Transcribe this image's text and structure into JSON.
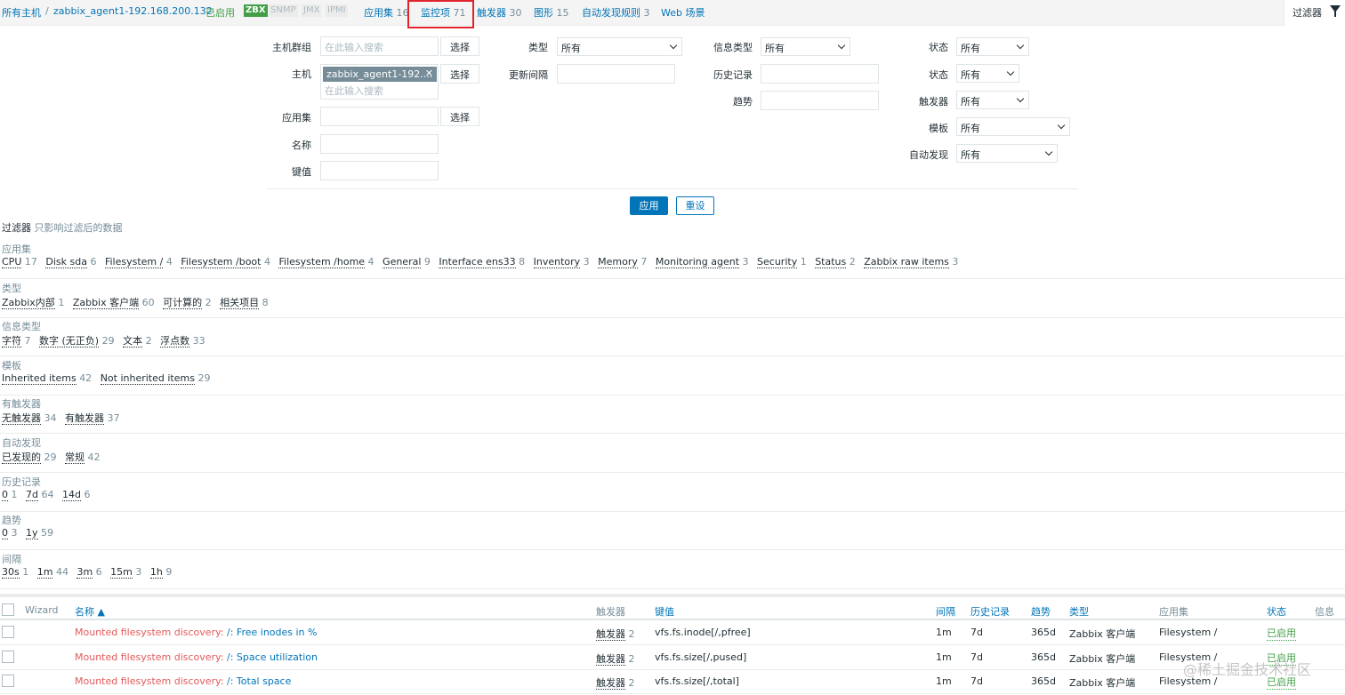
{
  "nav": {
    "all_hosts": "所有主机",
    "separator": "/",
    "host": "zabbix_agent1-192.168.200.132",
    "enabled": "已启用",
    "zbx": "ZBX",
    "snmp": "SNMP",
    "jmx": "JMX",
    "ipmi": "IPMI",
    "applications": "应用集",
    "applications_count": "16",
    "items": "监控项",
    "items_count": "71",
    "triggers": "触发器",
    "triggers_count": "30",
    "graphs": "图形",
    "graphs_count": "15",
    "discovery": "自动发现规则",
    "discovery_count": "3",
    "web": "Web 场景",
    "filter_tab": "过滤器"
  },
  "filter": {
    "host_group_label": "主机群组",
    "host_group_placeholder": "在此输入搜索",
    "select_btn": "选择",
    "host_label": "主机",
    "host_tag": "zabbix_agent1-192....",
    "host_placeholder": "在此输入搜索",
    "app_label": "应用集",
    "name_label": "名称",
    "key_label": "键值",
    "type_label": "类型",
    "type_value": "所有",
    "update_interval_label": "更新间隔",
    "info_type_label": "信息类型",
    "info_type_value": "所有",
    "history_label": "历史记录",
    "trends_label": "趋势",
    "state_label": "状态",
    "state_value": "所有",
    "status_label": "状态",
    "status_value": "所有",
    "triggers_label": "触发器",
    "triggers_value": "所有",
    "template_label": "模板",
    "template_value": "所有",
    "discovery_label": "自动发现",
    "discovery_value": "所有",
    "apply_btn": "应用",
    "reset_btn": "重设"
  },
  "subfilter": {
    "title": "过滤器",
    "note": "只影响过滤后的数据",
    "groups": [
      {
        "name": "应用集",
        "values": [
          {
            "t": "CPU",
            "n": "17"
          },
          {
            "t": "Disk sda",
            "n": "6"
          },
          {
            "t": "Filesystem /",
            "n": "4"
          },
          {
            "t": "Filesystem /boot",
            "n": "4"
          },
          {
            "t": "Filesystem /home",
            "n": "4"
          },
          {
            "t": "General",
            "n": "9"
          },
          {
            "t": "Interface ens33",
            "n": "8"
          },
          {
            "t": "Inventory",
            "n": "3"
          },
          {
            "t": "Memory",
            "n": "7"
          },
          {
            "t": "Monitoring agent",
            "n": "3"
          },
          {
            "t": "Security",
            "n": "1"
          },
          {
            "t": "Status",
            "n": "2"
          },
          {
            "t": "Zabbix raw items",
            "n": "3"
          }
        ]
      },
      {
        "name": "类型",
        "values": [
          {
            "t": "Zabbix内部",
            "n": "1"
          },
          {
            "t": "Zabbix 客户端",
            "n": "60"
          },
          {
            "t": "可计算的",
            "n": "2"
          },
          {
            "t": "相关项目",
            "n": "8"
          }
        ]
      },
      {
        "name": "信息类型",
        "values": [
          {
            "t": "字符",
            "n": "7"
          },
          {
            "t": "数字 (无正负)",
            "n": "29"
          },
          {
            "t": "文本",
            "n": "2"
          },
          {
            "t": "浮点数",
            "n": "33"
          }
        ]
      },
      {
        "name": "模板",
        "values": [
          {
            "t": "Inherited items",
            "n": "42"
          },
          {
            "t": "Not inherited items",
            "n": "29"
          }
        ]
      },
      {
        "name": "有触发器",
        "values": [
          {
            "t": "无触发器",
            "n": "34"
          },
          {
            "t": "有触发器",
            "n": "37"
          }
        ]
      },
      {
        "name": "自动发现",
        "values": [
          {
            "t": "已发现的",
            "n": "29"
          },
          {
            "t": "常规",
            "n": "42"
          }
        ]
      },
      {
        "name": "历史记录",
        "values": [
          {
            "t": "0",
            "n": "1"
          },
          {
            "t": "7d",
            "n": "64"
          },
          {
            "t": "14d",
            "n": "6"
          }
        ]
      },
      {
        "name": "趋势",
        "values": [
          {
            "t": "0",
            "n": "3"
          },
          {
            "t": "1y",
            "n": "59"
          }
        ]
      },
      {
        "name": "间隔",
        "values": [
          {
            "t": "30s",
            "n": "1"
          },
          {
            "t": "1m",
            "n": "44"
          },
          {
            "t": "3m",
            "n": "6"
          },
          {
            "t": "15m",
            "n": "3"
          },
          {
            "t": "1h",
            "n": "9"
          }
        ]
      }
    ]
  },
  "table": {
    "headers": {
      "wizard": "Wizard",
      "name": "名称 ▲",
      "triggers": "触发器",
      "key": "键值",
      "interval": "间隔",
      "history": "历史记录",
      "trends": "趋势",
      "type": "类型",
      "applications": "应用集",
      "status": "状态",
      "info": "信息"
    },
    "rows": [
      {
        "prefix": "Mounted filesystem discovery:",
        "name": " /: Free inodes in %",
        "trig": "触发器",
        "trig_n": "2",
        "key": "vfs.fs.inode[/,pfree]",
        "interval": "1m",
        "history": "7d",
        "trends": "365d",
        "type": "Zabbix 客户端",
        "app": "Filesystem /",
        "status": "已启用"
      },
      {
        "prefix": "Mounted filesystem discovery:",
        "name": " /: Space utilization",
        "trig": "触发器",
        "trig_n": "2",
        "key": "vfs.fs.size[/,pused]",
        "interval": "1m",
        "history": "7d",
        "trends": "365d",
        "type": "Zabbix 客户端",
        "app": "Filesystem /",
        "status": "已启用"
      },
      {
        "prefix": "Mounted filesystem discovery:",
        "name": " /: Total space",
        "trig": "触发器",
        "trig_n": "2",
        "key": "vfs.fs.size[/,total]",
        "interval": "1m",
        "history": "7d",
        "trends": "365d",
        "type": "Zabbix 客户端",
        "app": "Filesystem /",
        "status": "已启用"
      }
    ]
  },
  "watermark": "@稀土掘金技术社区",
  "colors": {
    "accent": "#0275b8",
    "enabled": "#429e47",
    "discovered": "#e45959",
    "highlight_box": "#e0242e"
  }
}
